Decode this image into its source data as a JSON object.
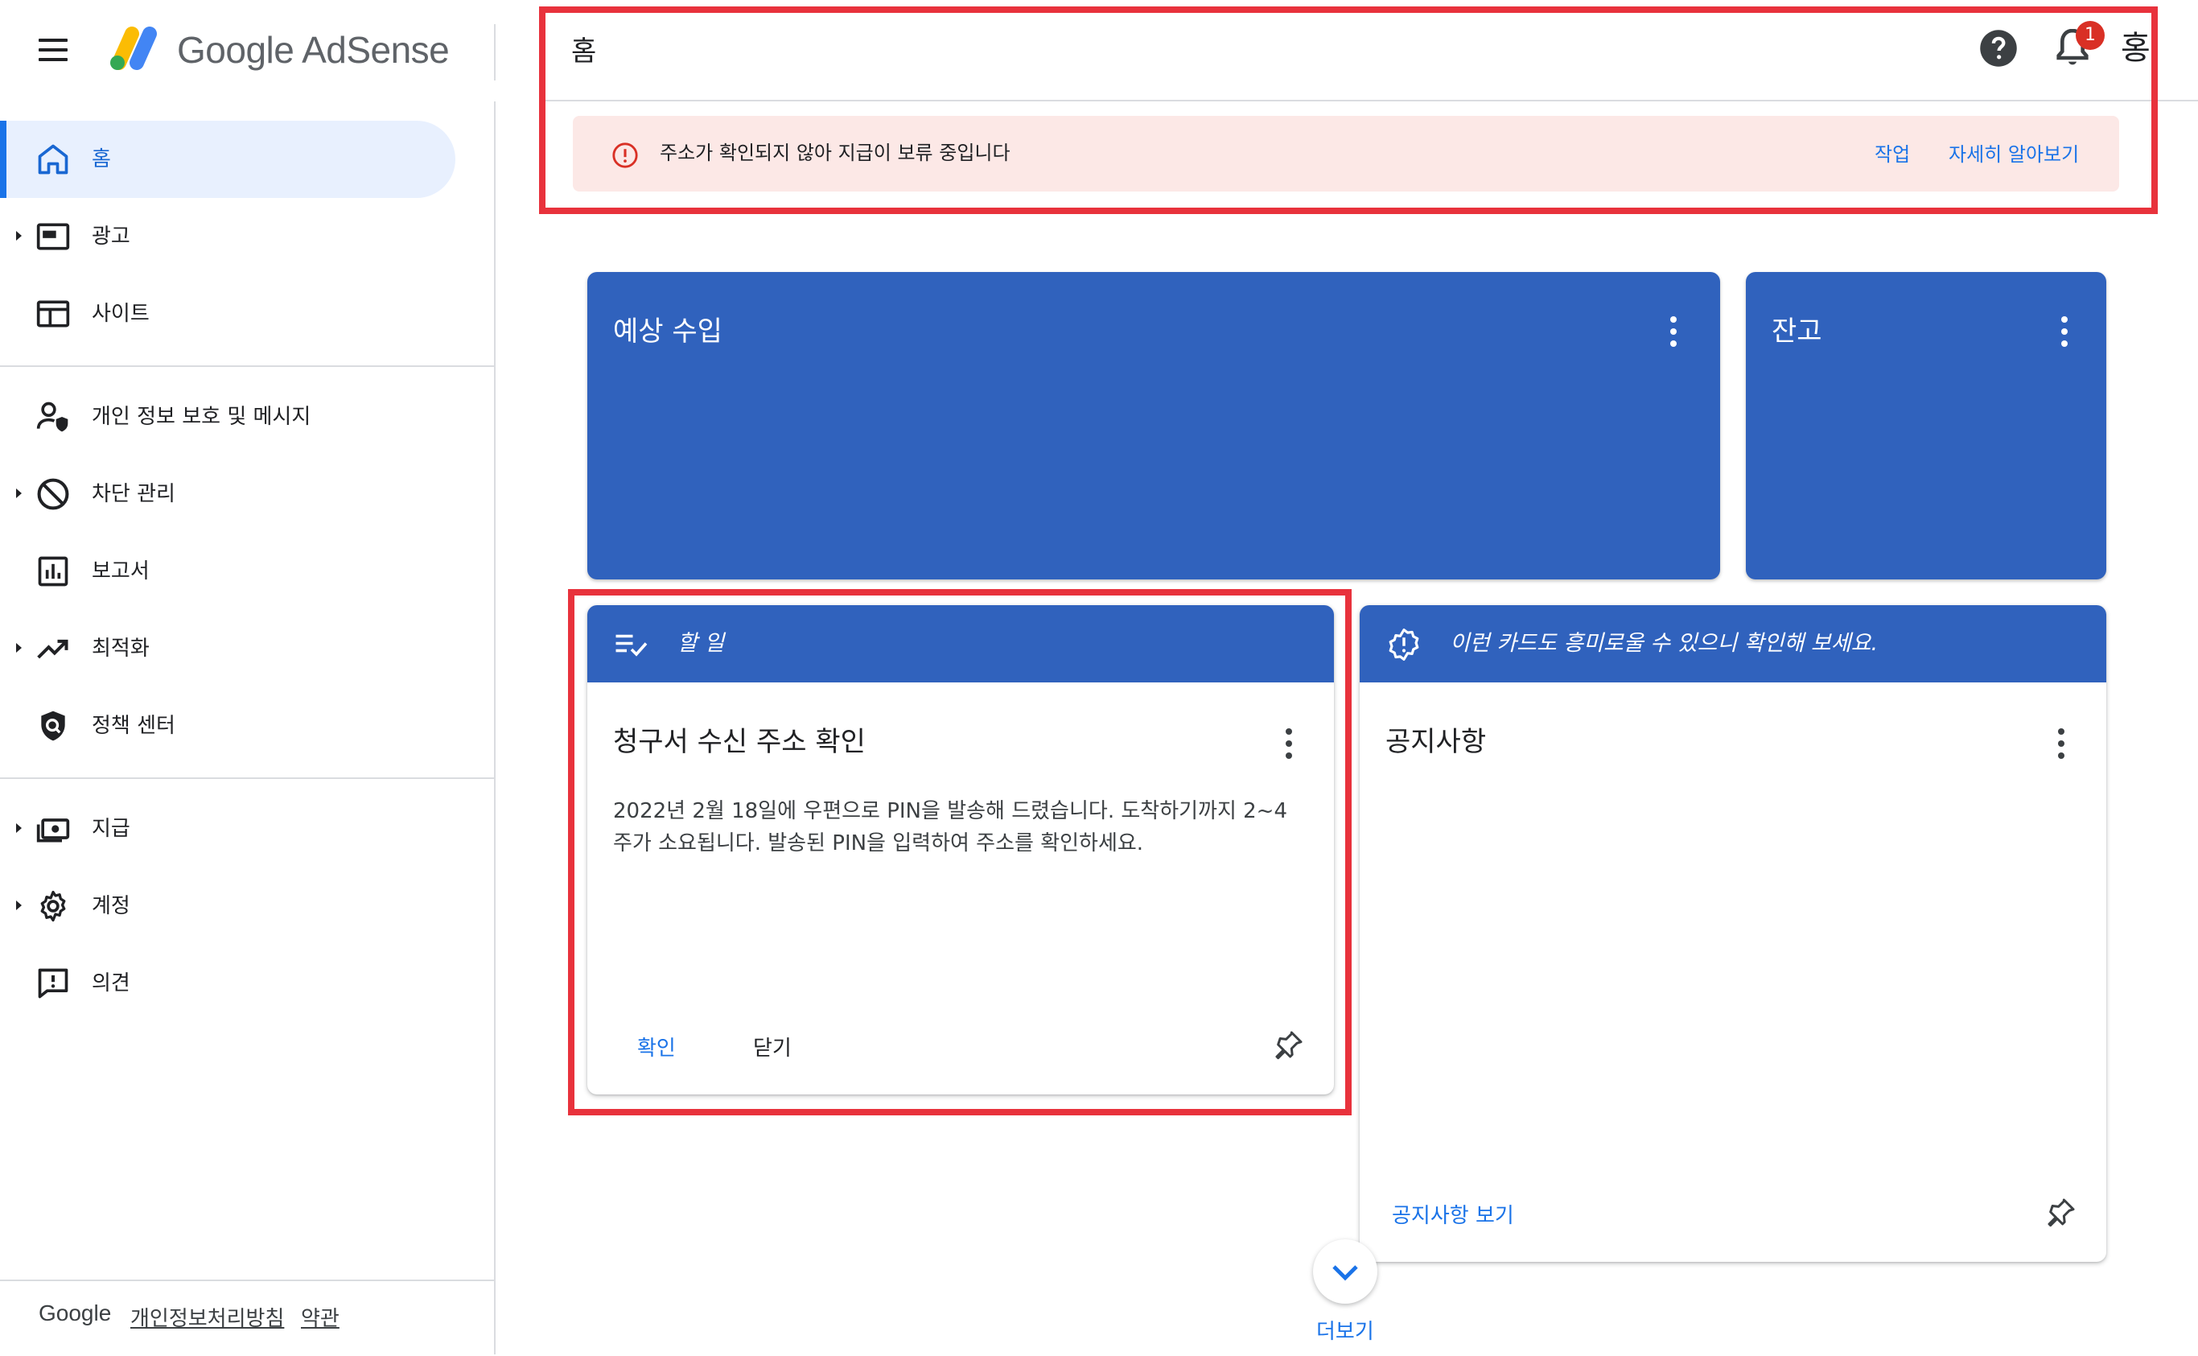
{
  "brand": {
    "name": "Google AdSense"
  },
  "header": {
    "title": "홈",
    "notification_count": "1",
    "avatar_glyph": "홍"
  },
  "alert": {
    "message": "주소가 확인되지 않아 지급이 보류 중입니다",
    "action_label": "작업",
    "learn_more_label": "자세히 알아보기"
  },
  "sidebar": {
    "items": [
      {
        "label": "홈",
        "icon": "home-icon",
        "active": true
      },
      {
        "label": "광고",
        "icon": "ad-unit-icon",
        "expandable": true
      },
      {
        "label": "사이트",
        "icon": "web-icon"
      },
      {
        "label": "개인 정보 보호 및 메시지",
        "icon": "privacy-user-icon"
      },
      {
        "label": "차단 관리",
        "icon": "block-icon",
        "expandable": true
      },
      {
        "label": "보고서",
        "icon": "bar-chart-icon"
      },
      {
        "label": "최적화",
        "icon": "trending-up-icon",
        "expandable": true
      },
      {
        "label": "정책 센터",
        "icon": "policy-shield-icon"
      },
      {
        "label": "지급",
        "icon": "payments-icon",
        "expandable": true
      },
      {
        "label": "계정",
        "icon": "settings-gear-icon",
        "expandable": true
      },
      {
        "label": "의견",
        "icon": "feedback-icon"
      }
    ]
  },
  "footer": {
    "google_label": "Google",
    "privacy_label": "개인정보처리방침",
    "terms_label": "약관"
  },
  "cards": {
    "estimated_earnings": {
      "title": "예상 수입"
    },
    "balance": {
      "title": "잔고"
    },
    "todo": {
      "header": "할 일",
      "title": "청구서 수신 주소 확인",
      "body": "2022년 2월 18일에 우편으로 PIN을 발송해 드렸습니다. 도착하기까지 2~4주가 소요됩니다. 발송된 PIN을 입력하여 주소를 확인하세요.",
      "confirm_label": "확인",
      "close_label": "닫기"
    },
    "suggestion": {
      "header": "이런 카드도 흥미로울 수 있으니 확인해 보세요.",
      "title": "공지사항",
      "link_label": "공지사항 보기"
    }
  },
  "more": {
    "label": "더보기"
  },
  "colors": {
    "accent_blue": "#1a73e8",
    "card_blue": "#3062bd",
    "alert_bg": "#fce8e6",
    "alert_red": "#d93025",
    "highlight_red": "#e8323c"
  }
}
